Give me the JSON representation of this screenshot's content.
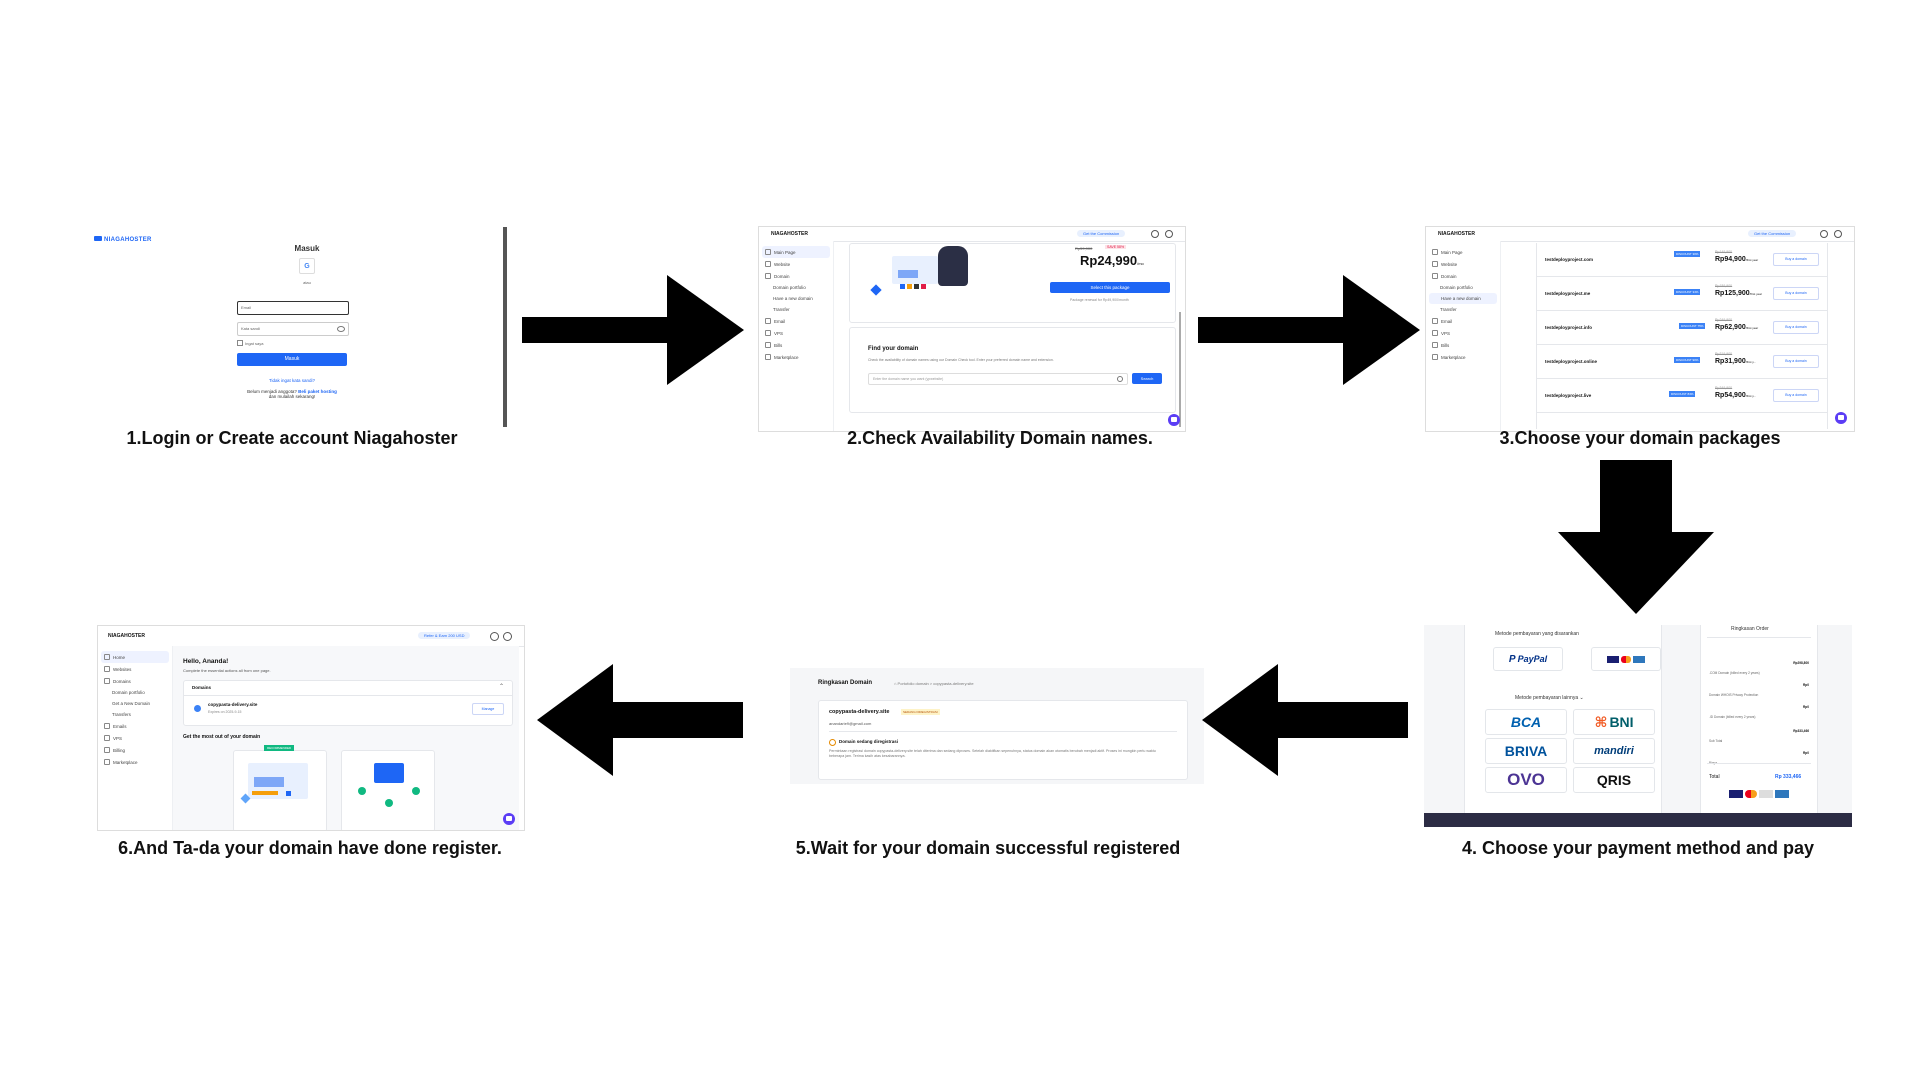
{
  "captions": {
    "step1": "1.Login or Create account Niagahoster",
    "step2": "2.Check Availability Domain names.",
    "step3": "3.Choose your domain packages",
    "step4": "4. Choose your payment method and pay",
    "step5": "5.Wait for your domain successful registered",
    "step6": "6.And Ta-da your domain have done register."
  },
  "brand": "NIAGAHOSTER",
  "step1": {
    "title": "Masuk",
    "or": "atau",
    "email_placeholder": "Email",
    "password_placeholder": "Kata sandi",
    "remember": "Ingat saya",
    "submit": "Masuk",
    "forgot": "Tidak ingat kata sandi?",
    "signup_prefix": "Belum menjadi anggota?",
    "signup_link": "Beli paket hosting",
    "signup_suffix": "dan mulailah sekarang!"
  },
  "step2": {
    "top_badge": "Get the Commission",
    "sidebar": [
      "Main Page",
      "Website",
      "Domain",
      "Domain portfolio",
      "Have a new domain",
      "Transfer",
      "Email",
      "VPS",
      "Bills",
      "Marketplace"
    ],
    "old_price": "Rp59,900",
    "save": "SAVE 58%",
    "price": "Rp24,990",
    "per": "/mo",
    "select_btn": "Select this package",
    "renew_note": "Package renewal for Rp49,900/month",
    "find_title": "Find your domain",
    "find_desc": "Check the availability of domain names using our Domain Check tool. Enter your preferred domain name and extension.",
    "search_placeholder": "Enter the domain name you want (ypwebsite)",
    "search_btn": "Search"
  },
  "step3": {
    "top_badge": "Get the Commission",
    "sidebar": [
      "Main Page",
      "Website",
      "Domain",
      "Domain portfolio",
      "Have a new domain",
      "Transfer",
      "Email",
      "VPS",
      "Bills",
      "Marketplace"
    ],
    "domains": [
      {
        "name": "testdeployproject.com",
        "badge": "DISCOUNT 30%",
        "old": "Rp149,900",
        "price": "Rp94,900",
        "per": "/first year",
        "btn": "Buy a domain"
      },
      {
        "name": "testdeployproject.me",
        "badge": "DISCOUNT 34%",
        "old": "Rp189,900",
        "price": "Rp125,900",
        "per": "/first year",
        "btn": "Buy a domain"
      },
      {
        "name": "testdeployproject.info",
        "badge": "DISCOUNT 75%",
        "old": "Rp249,900",
        "price": "Rp62,900",
        "per": "/first year",
        "btn": "Buy a domain"
      },
      {
        "name": "testdeployproject.online",
        "badge": "DISCOUNT 90%",
        "old": "Rp319,900",
        "price": "Rp31,900",
        "per": "/first y...",
        "btn": "Buy a domain"
      },
      {
        "name": "testdeployproject.live",
        "badge": "DISCOUNT 84%",
        "old": "Rp349,900",
        "price": "Rp54,900",
        "per": "/first y...",
        "btn": "Buy a domain"
      }
    ]
  },
  "step4": {
    "suggested_title": "Metode pembayaran yang disarankan",
    "other_title": "Metode pembayaran lainnya",
    "methods": [
      "BCA",
      "BNI",
      "BRIVA",
      "mandiri",
      "OVO",
      "QRIS"
    ],
    "paypal": "PayPal",
    "order_title": "Ringkasan Order",
    "order_lines": [
      {
        "label": ".COM Domain (billed every 2 years)",
        "value": "Rp298,800"
      },
      {
        "label": "Domain WHOIS Privacy Protection",
        "value": "Rp0"
      },
      {
        "label": ".ID Domain (billed every 2 years)",
        "value": "Rp0"
      },
      {
        "label": "Sub Total",
        "value": "Rp333,466"
      },
      {
        "label": "Biaya",
        "value": "Rp0"
      }
    ],
    "total_label": "Total",
    "total_value": "Rp 333,466"
  },
  "step5": {
    "title": "Ringkasan Domain",
    "breadcrumb": "Portofolio domain > copypasta-delivery.site",
    "domain": "copypasta-delivery.site",
    "status": "SEDANG DIREGISTRASI",
    "email": "anandarie9@gmail.com",
    "notice_title": "Domain sedang diregistrasi",
    "notice_text": "Permintaan registrasi domain copypasta-delivery.site telah diterima dan sedang diproses. Setelah diaktifkan sepenuhnya, status domain akan otomatis berubah menjadi aktif. Proses ini mungkin perlu waktu beberapa jam. Terima kasih atas kesabarannya."
  },
  "step6": {
    "top_badge": "Refer & Earn 200 USD",
    "sidebar": [
      "Home",
      "Websites",
      "Domains",
      "Domain portfolio",
      "Get a New Domain",
      "Transfers",
      "Emails",
      "VPS",
      "Billing",
      "Marketplace"
    ],
    "greeting": "Hello, Ananda!",
    "subtitle": "Complete the essential actions all from one page.",
    "domains_header": "Domains",
    "domain_name": "copypasta-delivery.site",
    "expires": "Expires on 2025-9-15",
    "manage": "Manage",
    "section_title": "Get the most out of your domain",
    "recommended": "RECOMMENDED"
  },
  "colors": {
    "primary_blue": "#1e66f5",
    "arrow": "#000000",
    "purple_badge": "#5b3df5"
  }
}
